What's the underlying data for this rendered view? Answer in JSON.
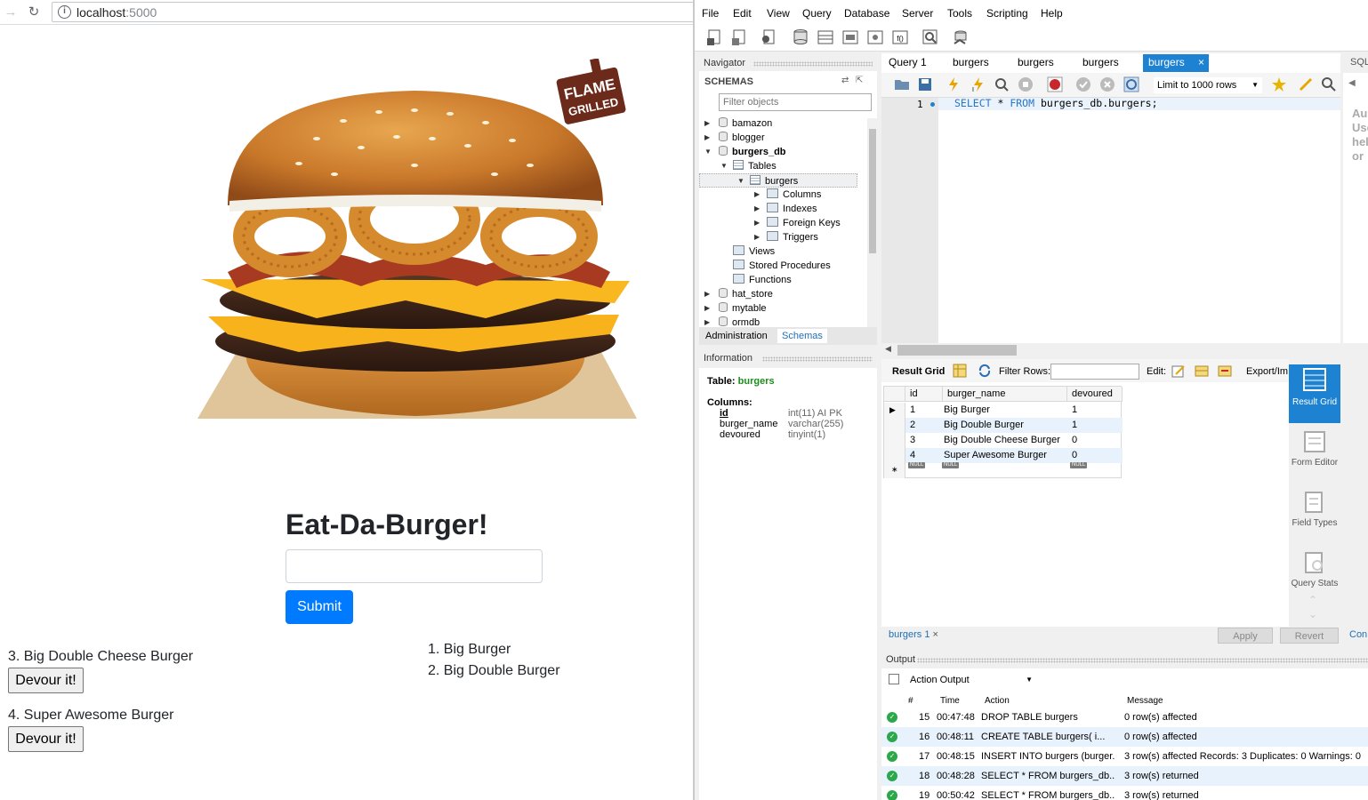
{
  "browser": {
    "url_host": "localhost",
    "url_port": ":5000"
  },
  "app": {
    "logo_text_line1": "FLAME",
    "logo_text_line2": "GRILLED",
    "title": "Eat-Da-Burger!",
    "input_value": "",
    "submit_label": "Submit",
    "uneaten": [
      {
        "label": "3. Big Double Cheese Burger",
        "button": "Devour it!"
      },
      {
        "label": "4. Super Awesome Burger",
        "button": "Devour it!"
      }
    ],
    "eaten": [
      "1. Big Burger",
      "2. Big Double Burger"
    ]
  },
  "workbench": {
    "menu": [
      "File",
      "Edit",
      "View",
      "Query",
      "Database",
      "Server",
      "Tools",
      "Scripting",
      "Help"
    ],
    "navigator": {
      "title": "Navigator",
      "schemas_label": "SCHEMAS",
      "filter_placeholder": "Filter objects",
      "tree": [
        "bamazon",
        "blogger",
        "burgers_db",
        "Tables",
        "burgers",
        "Columns",
        "Indexes",
        "Foreign Keys",
        "Triggers",
        "Views",
        "Stored Procedures",
        "Functions",
        "hat_store",
        "mytable",
        "ormdb"
      ],
      "tabs": [
        "Administration",
        "Schemas"
      ]
    },
    "information": {
      "title": "Information",
      "table_label": "Table:",
      "table_name": "burgers",
      "columns_label": "Columns:",
      "columns": [
        {
          "name": "id",
          "type": "int(11) AI PK"
        },
        {
          "name": "burger_name",
          "type": "varchar(255)"
        },
        {
          "name": "devoured",
          "type": "tinyint(1)"
        }
      ]
    },
    "query_tabs": [
      "Query 1",
      "burgers",
      "burgers",
      "burgers",
      "burgers"
    ],
    "sql_tab_label": "SQL",
    "limit_label": "Limit to 1000 rows",
    "line_number": "1",
    "sql": {
      "kw1": "SELECT",
      "mid": " * ",
      "kw2": "FROM",
      "rest": " burgers_db.burgers;"
    },
    "sql_help_text": [
      "Au",
      "Use",
      "hel",
      "or"
    ],
    "result": {
      "grid_label": "Result Grid",
      "filter_label": "Filter Rows:",
      "edit_label": "Edit:",
      "export_label": "Export/Im",
      "columns": [
        "id",
        "burger_name",
        "devoured"
      ],
      "rows": [
        [
          "1",
          "Big Burger",
          "1"
        ],
        [
          "2",
          "Big Double Burger",
          "1"
        ],
        [
          "3",
          "Big Double Cheese Burger",
          "0"
        ],
        [
          "4",
          "Super Awesome Burger",
          "0"
        ]
      ],
      "null_label": "NULL",
      "side_tabs": [
        "Result Grid",
        "Form Editor",
        "Field Types",
        "Query Stats"
      ],
      "bottom_tab": "burgers 1",
      "apply_label": "Apply",
      "revert_label": "Revert",
      "context_label": "Con"
    },
    "output": {
      "title": "Output",
      "select_label": "Action Output",
      "headers": [
        "#",
        "Time",
        "Action",
        "Message"
      ],
      "rows": [
        {
          "num": "15",
          "time": "00:47:48",
          "action": "DROP TABLE burgers",
          "message": "0 row(s) affected"
        },
        {
          "num": "16",
          "time": "00:48:11",
          "action": "CREATE TABLE burgers(    i...",
          "message": "0 row(s) affected"
        },
        {
          "num": "17",
          "time": "00:48:15",
          "action": "INSERT INTO burgers (burger...",
          "message": "3 row(s) affected Records: 3  Duplicates: 0  Warnings: 0"
        },
        {
          "num": "18",
          "time": "00:48:28",
          "action": "SELECT * FROM burgers_db....",
          "message": "3 row(s) returned"
        },
        {
          "num": "19",
          "time": "00:50:42",
          "action": "SELECT * FROM burgers_db....",
          "message": "3 row(s) returned"
        }
      ]
    },
    "colors": {
      "accent": "#1e82d2",
      "bootstrap_primary": "#007bff",
      "success": "#2ba84a"
    }
  }
}
